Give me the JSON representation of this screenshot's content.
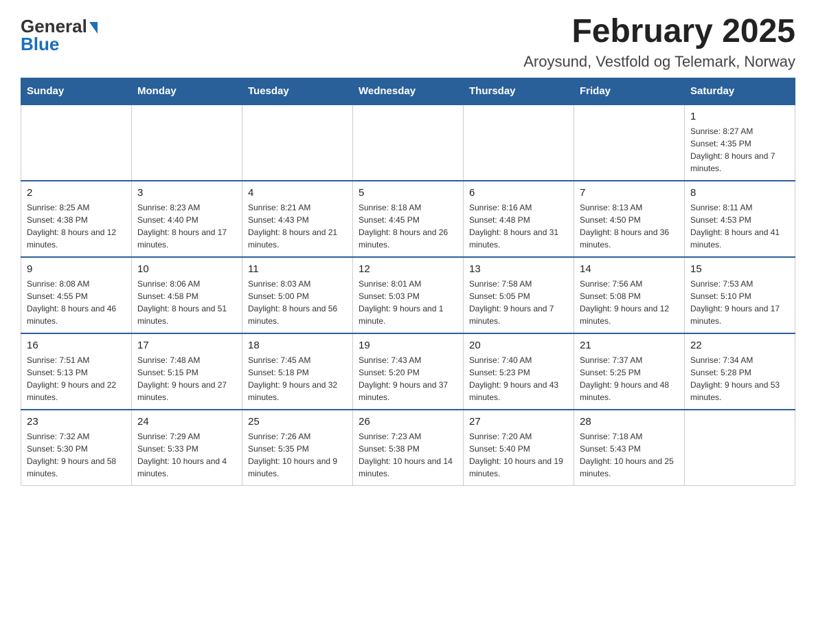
{
  "header": {
    "logo": {
      "general": "General",
      "blue": "Blue",
      "tagline": ""
    },
    "title": "February 2025",
    "location": "Aroysund, Vestfold og Telemark, Norway"
  },
  "weekdays": [
    "Sunday",
    "Monday",
    "Tuesday",
    "Wednesday",
    "Thursday",
    "Friday",
    "Saturday"
  ],
  "weeks": [
    [
      {
        "day": "",
        "info": ""
      },
      {
        "day": "",
        "info": ""
      },
      {
        "day": "",
        "info": ""
      },
      {
        "day": "",
        "info": ""
      },
      {
        "day": "",
        "info": ""
      },
      {
        "day": "",
        "info": ""
      },
      {
        "day": "1",
        "info": "Sunrise: 8:27 AM\nSunset: 4:35 PM\nDaylight: 8 hours and 7 minutes."
      }
    ],
    [
      {
        "day": "2",
        "info": "Sunrise: 8:25 AM\nSunset: 4:38 PM\nDaylight: 8 hours and 12 minutes."
      },
      {
        "day": "3",
        "info": "Sunrise: 8:23 AM\nSunset: 4:40 PM\nDaylight: 8 hours and 17 minutes."
      },
      {
        "day": "4",
        "info": "Sunrise: 8:21 AM\nSunset: 4:43 PM\nDaylight: 8 hours and 21 minutes."
      },
      {
        "day": "5",
        "info": "Sunrise: 8:18 AM\nSunset: 4:45 PM\nDaylight: 8 hours and 26 minutes."
      },
      {
        "day": "6",
        "info": "Sunrise: 8:16 AM\nSunset: 4:48 PM\nDaylight: 8 hours and 31 minutes."
      },
      {
        "day": "7",
        "info": "Sunrise: 8:13 AM\nSunset: 4:50 PM\nDaylight: 8 hours and 36 minutes."
      },
      {
        "day": "8",
        "info": "Sunrise: 8:11 AM\nSunset: 4:53 PM\nDaylight: 8 hours and 41 minutes."
      }
    ],
    [
      {
        "day": "9",
        "info": "Sunrise: 8:08 AM\nSunset: 4:55 PM\nDaylight: 8 hours and 46 minutes."
      },
      {
        "day": "10",
        "info": "Sunrise: 8:06 AM\nSunset: 4:58 PM\nDaylight: 8 hours and 51 minutes."
      },
      {
        "day": "11",
        "info": "Sunrise: 8:03 AM\nSunset: 5:00 PM\nDaylight: 8 hours and 56 minutes."
      },
      {
        "day": "12",
        "info": "Sunrise: 8:01 AM\nSunset: 5:03 PM\nDaylight: 9 hours and 1 minute."
      },
      {
        "day": "13",
        "info": "Sunrise: 7:58 AM\nSunset: 5:05 PM\nDaylight: 9 hours and 7 minutes."
      },
      {
        "day": "14",
        "info": "Sunrise: 7:56 AM\nSunset: 5:08 PM\nDaylight: 9 hours and 12 minutes."
      },
      {
        "day": "15",
        "info": "Sunrise: 7:53 AM\nSunset: 5:10 PM\nDaylight: 9 hours and 17 minutes."
      }
    ],
    [
      {
        "day": "16",
        "info": "Sunrise: 7:51 AM\nSunset: 5:13 PM\nDaylight: 9 hours and 22 minutes."
      },
      {
        "day": "17",
        "info": "Sunrise: 7:48 AM\nSunset: 5:15 PM\nDaylight: 9 hours and 27 minutes."
      },
      {
        "day": "18",
        "info": "Sunrise: 7:45 AM\nSunset: 5:18 PM\nDaylight: 9 hours and 32 minutes."
      },
      {
        "day": "19",
        "info": "Sunrise: 7:43 AM\nSunset: 5:20 PM\nDaylight: 9 hours and 37 minutes."
      },
      {
        "day": "20",
        "info": "Sunrise: 7:40 AM\nSunset: 5:23 PM\nDaylight: 9 hours and 43 minutes."
      },
      {
        "day": "21",
        "info": "Sunrise: 7:37 AM\nSunset: 5:25 PM\nDaylight: 9 hours and 48 minutes."
      },
      {
        "day": "22",
        "info": "Sunrise: 7:34 AM\nSunset: 5:28 PM\nDaylight: 9 hours and 53 minutes."
      }
    ],
    [
      {
        "day": "23",
        "info": "Sunrise: 7:32 AM\nSunset: 5:30 PM\nDaylight: 9 hours and 58 minutes."
      },
      {
        "day": "24",
        "info": "Sunrise: 7:29 AM\nSunset: 5:33 PM\nDaylight: 10 hours and 4 minutes."
      },
      {
        "day": "25",
        "info": "Sunrise: 7:26 AM\nSunset: 5:35 PM\nDaylight: 10 hours and 9 minutes."
      },
      {
        "day": "26",
        "info": "Sunrise: 7:23 AM\nSunset: 5:38 PM\nDaylight: 10 hours and 14 minutes."
      },
      {
        "day": "27",
        "info": "Sunrise: 7:20 AM\nSunset: 5:40 PM\nDaylight: 10 hours and 19 minutes."
      },
      {
        "day": "28",
        "info": "Sunrise: 7:18 AM\nSunset: 5:43 PM\nDaylight: 10 hours and 25 minutes."
      },
      {
        "day": "",
        "info": ""
      }
    ]
  ]
}
